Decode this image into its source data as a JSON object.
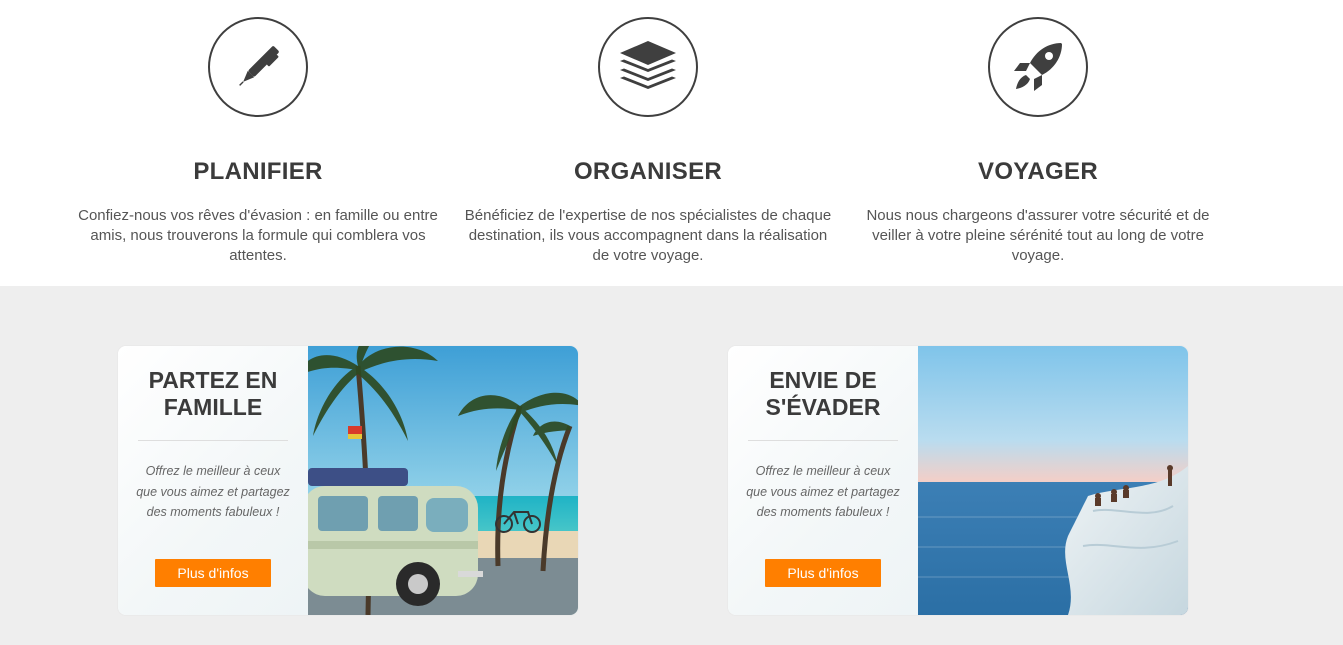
{
  "features": [
    {
      "icon": "pen-icon",
      "title": "PLANIFIER",
      "text": "Confiez-nous vos rêves d'évasion : en famille ou entre amis, nous trouverons la formule qui comblera vos attentes."
    },
    {
      "icon": "layers-icon",
      "title": "ORGANISER",
      "text": "Bénéficiez de l'expertise de nos spécialistes de chaque destination, ils vous accompagnent dans la réalisation de votre voyage."
    },
    {
      "icon": "rocket-icon",
      "title": "VOYAGER",
      "text": "Nous nous chargeons d'assurer votre sécurité et de veiller à votre pleine sérénité tout au long de votre voyage."
    }
  ],
  "promos": [
    {
      "title": "PARTEZ EN FAMILLE",
      "text": "Offrez le meilleur à ceux que vous aimez et partagez des moments fabuleux !",
      "button": "Plus d'infos",
      "image": "beach-van-photo"
    },
    {
      "title": "ENVIE DE S'ÉVADER",
      "text": "Offrez le meilleur à ceux que vous aimez et partagez des moments fabuleux !",
      "button": "Plus d'infos",
      "image": "coastal-cliff-photo"
    }
  ],
  "colors": {
    "accent": "#ff7f00",
    "section_bg": "#eeeeee",
    "heading": "#3b3b3b"
  }
}
